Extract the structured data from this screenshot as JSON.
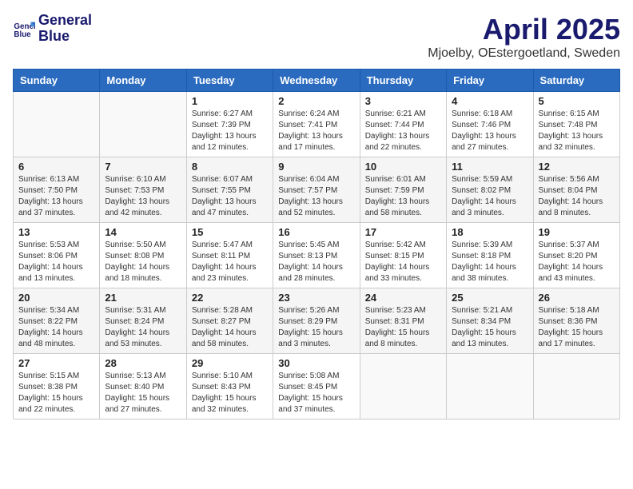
{
  "logo": {
    "line1": "General",
    "line2": "Blue"
  },
  "title": "April 2025",
  "subtitle": "Mjoelby, OEstergoetland, Sweden",
  "days_of_week": [
    "Sunday",
    "Monday",
    "Tuesday",
    "Wednesday",
    "Thursday",
    "Friday",
    "Saturday"
  ],
  "weeks": [
    [
      {
        "day": "",
        "info": ""
      },
      {
        "day": "",
        "info": ""
      },
      {
        "day": "1",
        "info": "Sunrise: 6:27 AM\nSunset: 7:39 PM\nDaylight: 13 hours and 12 minutes."
      },
      {
        "day": "2",
        "info": "Sunrise: 6:24 AM\nSunset: 7:41 PM\nDaylight: 13 hours and 17 minutes."
      },
      {
        "day": "3",
        "info": "Sunrise: 6:21 AM\nSunset: 7:44 PM\nDaylight: 13 hours and 22 minutes."
      },
      {
        "day": "4",
        "info": "Sunrise: 6:18 AM\nSunset: 7:46 PM\nDaylight: 13 hours and 27 minutes."
      },
      {
        "day": "5",
        "info": "Sunrise: 6:15 AM\nSunset: 7:48 PM\nDaylight: 13 hours and 32 minutes."
      }
    ],
    [
      {
        "day": "6",
        "info": "Sunrise: 6:13 AM\nSunset: 7:50 PM\nDaylight: 13 hours and 37 minutes."
      },
      {
        "day": "7",
        "info": "Sunrise: 6:10 AM\nSunset: 7:53 PM\nDaylight: 13 hours and 42 minutes."
      },
      {
        "day": "8",
        "info": "Sunrise: 6:07 AM\nSunset: 7:55 PM\nDaylight: 13 hours and 47 minutes."
      },
      {
        "day": "9",
        "info": "Sunrise: 6:04 AM\nSunset: 7:57 PM\nDaylight: 13 hours and 52 minutes."
      },
      {
        "day": "10",
        "info": "Sunrise: 6:01 AM\nSunset: 7:59 PM\nDaylight: 13 hours and 58 minutes."
      },
      {
        "day": "11",
        "info": "Sunrise: 5:59 AM\nSunset: 8:02 PM\nDaylight: 14 hours and 3 minutes."
      },
      {
        "day": "12",
        "info": "Sunrise: 5:56 AM\nSunset: 8:04 PM\nDaylight: 14 hours and 8 minutes."
      }
    ],
    [
      {
        "day": "13",
        "info": "Sunrise: 5:53 AM\nSunset: 8:06 PM\nDaylight: 14 hours and 13 minutes."
      },
      {
        "day": "14",
        "info": "Sunrise: 5:50 AM\nSunset: 8:08 PM\nDaylight: 14 hours and 18 minutes."
      },
      {
        "day": "15",
        "info": "Sunrise: 5:47 AM\nSunset: 8:11 PM\nDaylight: 14 hours and 23 minutes."
      },
      {
        "day": "16",
        "info": "Sunrise: 5:45 AM\nSunset: 8:13 PM\nDaylight: 14 hours and 28 minutes."
      },
      {
        "day": "17",
        "info": "Sunrise: 5:42 AM\nSunset: 8:15 PM\nDaylight: 14 hours and 33 minutes."
      },
      {
        "day": "18",
        "info": "Sunrise: 5:39 AM\nSunset: 8:18 PM\nDaylight: 14 hours and 38 minutes."
      },
      {
        "day": "19",
        "info": "Sunrise: 5:37 AM\nSunset: 8:20 PM\nDaylight: 14 hours and 43 minutes."
      }
    ],
    [
      {
        "day": "20",
        "info": "Sunrise: 5:34 AM\nSunset: 8:22 PM\nDaylight: 14 hours and 48 minutes."
      },
      {
        "day": "21",
        "info": "Sunrise: 5:31 AM\nSunset: 8:24 PM\nDaylight: 14 hours and 53 minutes."
      },
      {
        "day": "22",
        "info": "Sunrise: 5:28 AM\nSunset: 8:27 PM\nDaylight: 14 hours and 58 minutes."
      },
      {
        "day": "23",
        "info": "Sunrise: 5:26 AM\nSunset: 8:29 PM\nDaylight: 15 hours and 3 minutes."
      },
      {
        "day": "24",
        "info": "Sunrise: 5:23 AM\nSunset: 8:31 PM\nDaylight: 15 hours and 8 minutes."
      },
      {
        "day": "25",
        "info": "Sunrise: 5:21 AM\nSunset: 8:34 PM\nDaylight: 15 hours and 13 minutes."
      },
      {
        "day": "26",
        "info": "Sunrise: 5:18 AM\nSunset: 8:36 PM\nDaylight: 15 hours and 17 minutes."
      }
    ],
    [
      {
        "day": "27",
        "info": "Sunrise: 5:15 AM\nSunset: 8:38 PM\nDaylight: 15 hours and 22 minutes."
      },
      {
        "day": "28",
        "info": "Sunrise: 5:13 AM\nSunset: 8:40 PM\nDaylight: 15 hours and 27 minutes."
      },
      {
        "day": "29",
        "info": "Sunrise: 5:10 AM\nSunset: 8:43 PM\nDaylight: 15 hours and 32 minutes."
      },
      {
        "day": "30",
        "info": "Sunrise: 5:08 AM\nSunset: 8:45 PM\nDaylight: 15 hours and 37 minutes."
      },
      {
        "day": "",
        "info": ""
      },
      {
        "day": "",
        "info": ""
      },
      {
        "day": "",
        "info": ""
      }
    ]
  ]
}
